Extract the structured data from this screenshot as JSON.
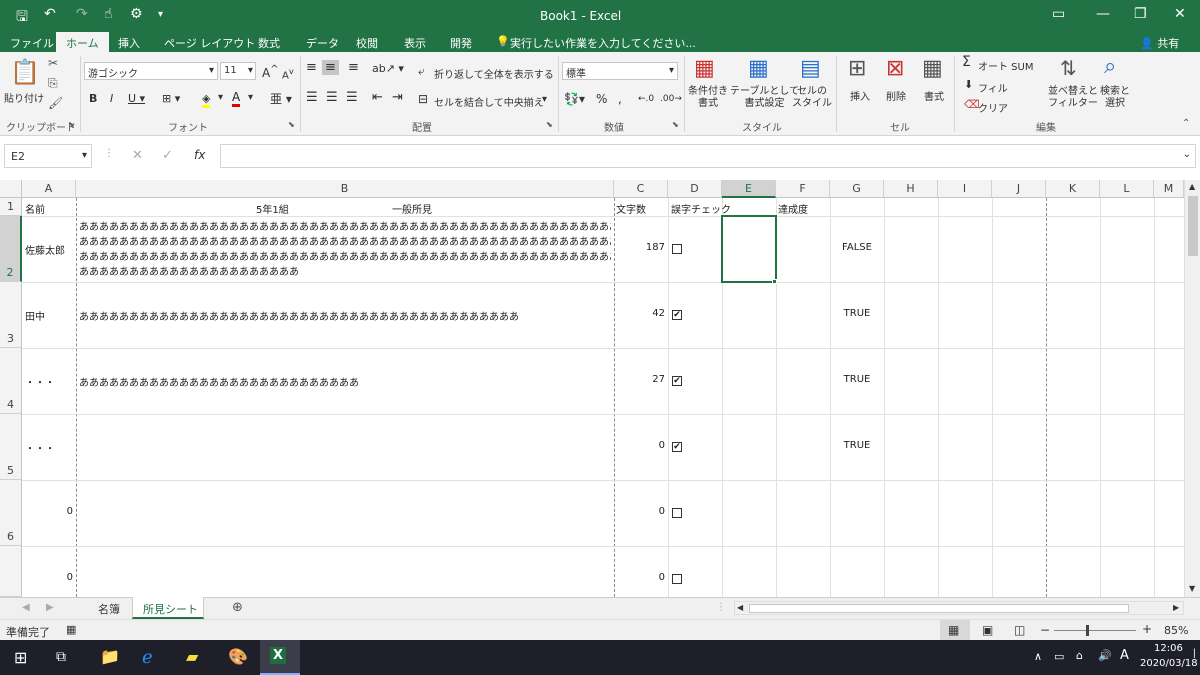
{
  "title_bar": {
    "title": "Book1 - Excel"
  },
  "tabs": [
    "ファイル",
    "ホーム",
    "挿入",
    "ページ レイアウト",
    "数式",
    "データ",
    "校閲",
    "表示",
    "開発"
  ],
  "tell_me": "実行したい作業を入力してください...",
  "share": "共有",
  "ribbon": {
    "paste": "貼り付け",
    "clipboard": "クリップボード",
    "font_name": "游ゴシック",
    "font_size": "11",
    "font_group": "フォント",
    "wrap": "折り返して全体を表示する",
    "merge": "セルを結合して中央揃え",
    "align_group": "配置",
    "number_format": "標準",
    "number_group": "数値",
    "cond_format": "条件付き\n書式",
    "table_format": "テーブルとして\n書式設定",
    "cell_style": "セルの\nスタイル",
    "style_group": "スタイル",
    "insert": "挿入",
    "delete": "削除",
    "format": "書式",
    "cells_group": "セル",
    "autosum": "オート SUM",
    "fill": "フィル",
    "clear": "クリア",
    "sort": "並べ替えと\nフィルター",
    "find": "検索と\n選択",
    "edit_group": "編集"
  },
  "name_box": "E2",
  "formula": "",
  "columns": [
    "A",
    "B",
    "C",
    "D",
    "E",
    "F",
    "G",
    "H",
    "I",
    "J",
    "K",
    "L",
    "M"
  ],
  "row_numbers": [
    "1",
    "2",
    "3",
    "4",
    "5",
    "6"
  ],
  "header_row": {
    "a": "名前",
    "b1": "5年1組",
    "b2": "一般所見",
    "c": "文字数",
    "d": "誤字チェック",
    "f": "達成度"
  },
  "rows": [
    {
      "a": "佐藤太郎",
      "b": [
        "ああああああああああああああああああああああああああああああああああああああああああああああああああああああ",
        "ああああああああああああああああああああああああああああああああああああああああああああああああああああああ",
        "ああああああああああああああああああああああああああああああああああああああああああああああああああああああ",
        "ああああああああああああああああああああああ"
      ],
      "c": "187",
      "d": "",
      "g": "FALSE"
    },
    {
      "a": "田中",
      "b": [
        "ああああああああああああああああああああああああああああああああああああああああああああ"
      ],
      "c": "42",
      "d": "✔",
      "g": "TRUE"
    },
    {
      "a": "・・・",
      "b": [
        "ああああああああああああああああああああああああああああ"
      ],
      "c": "27",
      "d": "✔",
      "g": "TRUE"
    },
    {
      "a": "・・・",
      "b": [
        ""
      ],
      "c": "0",
      "d": "✔",
      "g": "TRUE"
    },
    {
      "a": "0",
      "b": [
        ""
      ],
      "c": "0",
      "d": "",
      "g": ""
    },
    {
      "a": "0",
      "b": [
        ""
      ],
      "c": "0",
      "d": "",
      "g": ""
    }
  ],
  "sheet_tabs": [
    "名簿",
    "所見シート"
  ],
  "status": {
    "ready": "準備完了",
    "zoom": "85%"
  },
  "taskbar": {
    "time": "12:06",
    "date": "2020/03/18",
    "ime": "A"
  }
}
